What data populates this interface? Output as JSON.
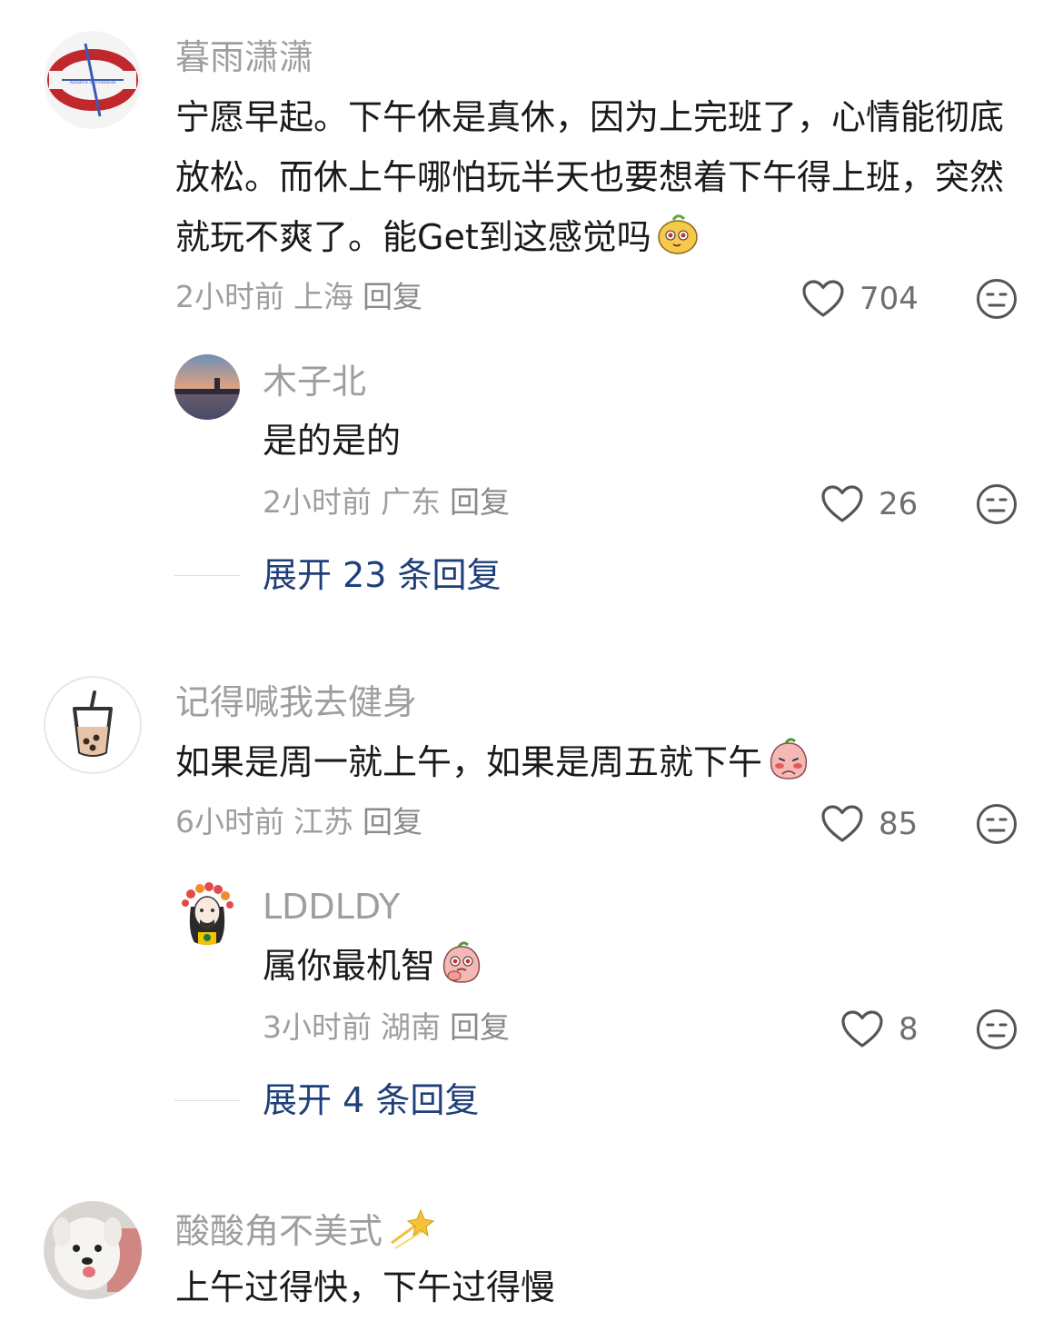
{
  "comments": [
    {
      "username": "暮雨潇潇",
      "text": "宁愿早起。下午休是真休，因为上完班了，心情能彻底放松。而休上午哪怕玩半天也要想着下午得上班，突然就玩不爽了。能Get到这感觉吗",
      "emoji": "yellow-cat-face-emoji",
      "time": "2小时前",
      "location": "上海",
      "reply_label": "回复",
      "likes": "704",
      "avatar": "red-white-emblem-avatar",
      "replies": [
        {
          "username": "木子北",
          "text": "是的是的",
          "time": "2小时前",
          "location": "广东",
          "reply_label": "回复",
          "likes": "26",
          "avatar": "sunset-lake-avatar"
        }
      ],
      "expand_label": "展开 23 条回复"
    },
    {
      "username": "记得喊我去健身",
      "text": "如果是周一就上午，如果是周五就下午",
      "emoji": "pink-peach-shy-emoji",
      "time": "6小时前",
      "location": "江苏",
      "reply_label": "回复",
      "likes": "85",
      "avatar": "bubble-tea-avatar",
      "replies": [
        {
          "username": "LDDLDY",
          "text": "属你最机智",
          "emoji": "pink-peach-thinking-emoji",
          "time": "3小时前",
          "location": "湖南",
          "reply_label": "回复",
          "likes": "8",
          "avatar": "flower-crown-cartoon-avatar"
        }
      ],
      "expand_label": "展开 4 条回复"
    },
    {
      "username": "酸酸角不美式",
      "username_emoji": "sparkle-star-emoji",
      "text": "上午过得快，下午过得慢",
      "avatar": "white-dog-avatar"
    }
  ],
  "colors": {
    "username": "#9e9e9e",
    "text": "#1a1a1a",
    "expand": "#1f3f7a",
    "meta": "#9e9e9e"
  }
}
